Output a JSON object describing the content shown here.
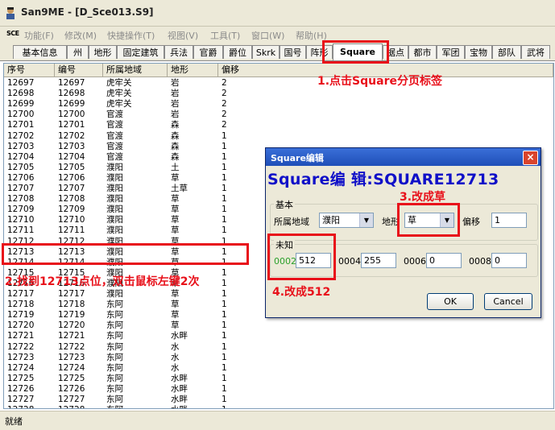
{
  "window": {
    "title": "San9ME - [D_Sce013.S9]"
  },
  "menu": [
    "功能(F)",
    "修改(M)",
    "快捷操作(T)",
    "视图(V)",
    "工具(T)",
    "窗口(W)",
    "帮助(H)"
  ],
  "menu_sys_icon": "SCE",
  "tabs": [
    "基本信息",
    "州",
    "地形",
    "固定建筑",
    "兵法",
    "官爵",
    "爵位",
    "Skrk",
    "国号",
    "阵形",
    "Square",
    "据点",
    "都市",
    "军团",
    "宝物",
    "部队",
    "武将"
  ],
  "list": {
    "columns": [
      "序号",
      "编号",
      "所属地域",
      "地形",
      "偏移"
    ],
    "rows": [
      [
        "12697",
        "12697",
        "虎牢关",
        "岩",
        "2"
      ],
      [
        "12698",
        "12698",
        "虎牢关",
        "岩",
        "2"
      ],
      [
        "12699",
        "12699",
        "虎牢关",
        "岩",
        "2"
      ],
      [
        "12700",
        "12700",
        "官渡",
        "岩",
        "2"
      ],
      [
        "12701",
        "12701",
        "官渡",
        "森",
        "2"
      ],
      [
        "12702",
        "12702",
        "官渡",
        "森",
        "1"
      ],
      [
        "12703",
        "12703",
        "官渡",
        "森",
        "1"
      ],
      [
        "12704",
        "12704",
        "官渡",
        "森",
        "1"
      ],
      [
        "12705",
        "12705",
        "濮阳",
        "土",
        "1"
      ],
      [
        "12706",
        "12706",
        "濮阳",
        "草",
        "1"
      ],
      [
        "12707",
        "12707",
        "濮阳",
        "土草",
        "1"
      ],
      [
        "12708",
        "12708",
        "濮阳",
        "草",
        "1"
      ],
      [
        "12709",
        "12709",
        "濮阳",
        "草",
        "1"
      ],
      [
        "12710",
        "12710",
        "濮阳",
        "草",
        "1"
      ],
      [
        "12711",
        "12711",
        "濮阳",
        "草",
        "1"
      ],
      [
        "12712",
        "12712",
        "濮阳",
        "草",
        "1"
      ],
      [
        "12713",
        "12713",
        "濮阳",
        "草",
        "1"
      ],
      [
        "12714",
        "12714",
        "濮阳",
        "草",
        "1"
      ],
      [
        "12715",
        "12715",
        "濮阳",
        "草",
        "1"
      ],
      [
        "12716",
        "12716",
        "濮阳",
        "草",
        "1"
      ],
      [
        "12717",
        "12717",
        "濮阳",
        "草",
        "1"
      ],
      [
        "12718",
        "12718",
        "东阿",
        "草",
        "1"
      ],
      [
        "12719",
        "12719",
        "东阿",
        "草",
        "1"
      ],
      [
        "12720",
        "12720",
        "东阿",
        "草",
        "1"
      ],
      [
        "12721",
        "12721",
        "东阿",
        "水畔",
        "1"
      ],
      [
        "12722",
        "12722",
        "东阿",
        "水",
        "1"
      ],
      [
        "12723",
        "12723",
        "东阿",
        "水",
        "1"
      ],
      [
        "12724",
        "12724",
        "东阿",
        "水",
        "1"
      ],
      [
        "12725",
        "12725",
        "东阿",
        "水畔",
        "1"
      ],
      [
        "12726",
        "12726",
        "东阿",
        "水畔",
        "1"
      ],
      [
        "12727",
        "12727",
        "东阿",
        "水畔",
        "1"
      ],
      [
        "12728",
        "12728",
        "东阿",
        "水畔",
        "1"
      ]
    ]
  },
  "status": "就绪",
  "annotations": {
    "a1": "1.点击Square分页标签",
    "a2": "2.找到12713点位，双击鼠标左键2次",
    "a3": "3.改成草",
    "a4": "4.改成512"
  },
  "dialog": {
    "title": "Square编辑",
    "heading": "Square编 辑:SQUARE12713",
    "group_basic": "基本",
    "region_label": "所属地域",
    "region_value": "濮阳",
    "terrain_label": "地形",
    "terrain_value": "草",
    "offset_label": "偏移",
    "offset_value": "1",
    "group_unknown": "未知",
    "f0002_label": "0002",
    "f0002_value": "512",
    "f0004_label": "0004",
    "f0004_value": "255",
    "f0006_label": "0006",
    "f0006_value": "0",
    "f0008_label": "0008",
    "f0008_value": "0",
    "ok": "OK",
    "cancel": "Cancel",
    "close": "×"
  },
  "colors": {
    "annotation": "#e8101a",
    "heading": "#1010c8",
    "green_label": "#2aa02a"
  }
}
